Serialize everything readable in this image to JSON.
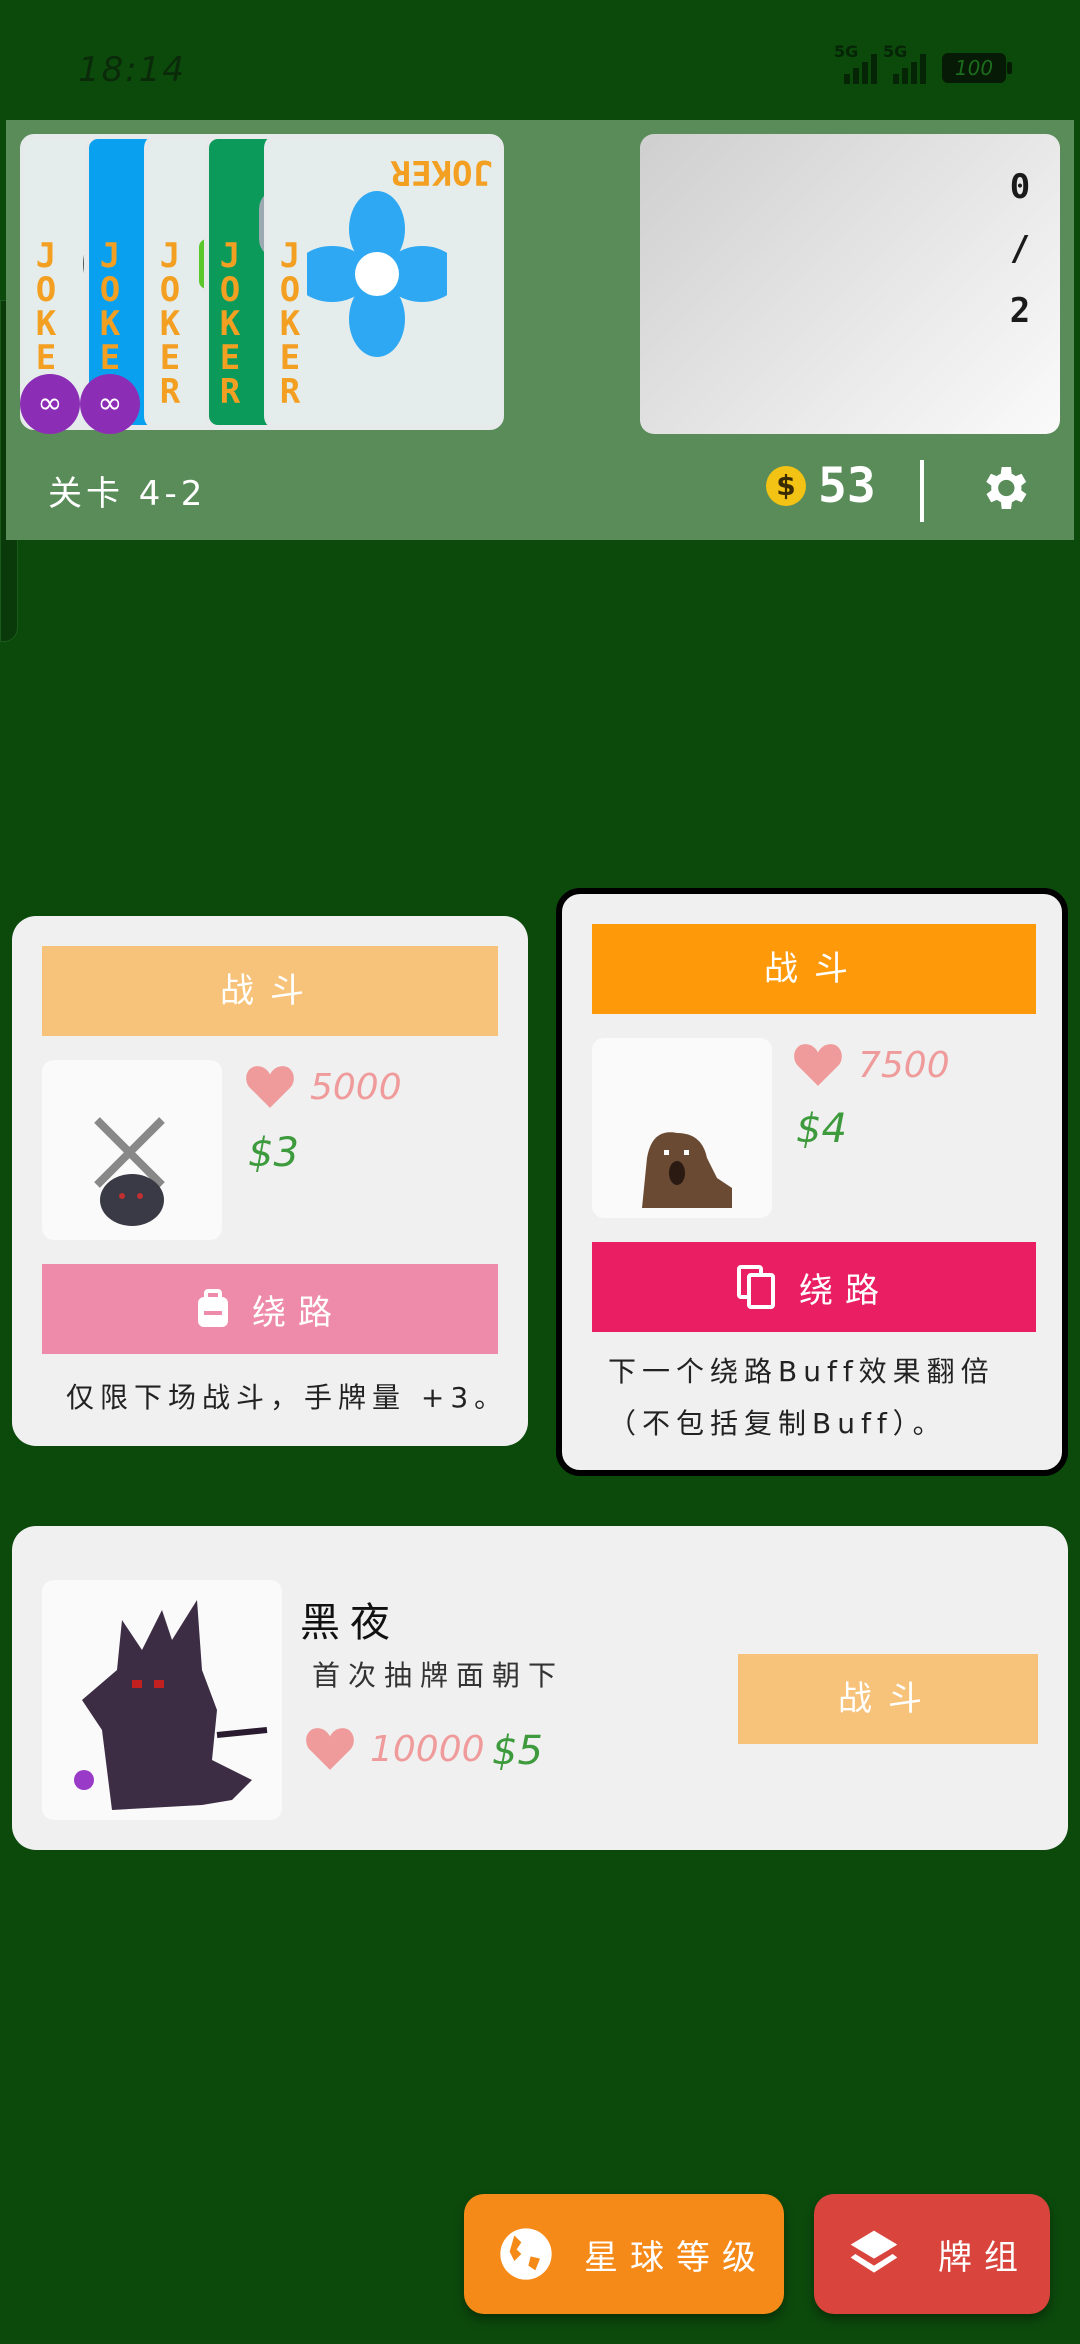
{
  "status_bar": {
    "time": "18:14",
    "network_1": "5G",
    "network_2": "5G",
    "battery": "100"
  },
  "top_panel": {
    "jokers": [
      {
        "label": "JOKER",
        "color": "#e4ecec",
        "infinite": true
      },
      {
        "label": "JOKER",
        "color": "#0aa0f0",
        "infinite": true
      },
      {
        "label": "JOKER",
        "color": "#e4ecec",
        "infinite": false
      },
      {
        "label": "JOKER",
        "color": "#0c9a5a",
        "infinite": false
      },
      {
        "label": "JOKER",
        "color": "#e4ecec",
        "infinite": false
      }
    ],
    "infinite_symbol": "∞",
    "slot_counter": {
      "current": "0",
      "separator": "/",
      "max": "2"
    },
    "level_label": "关卡 4-2",
    "money": "53",
    "coin_symbol": "$"
  },
  "boss_small_1": {
    "fight_label": "战斗",
    "hp": "5000",
    "reward": "$3",
    "skip_label": "绕路",
    "description": "仅限下场战斗，手牌量 +3。",
    "colors": {
      "fight": "#f7c27a",
      "skip": "#ee8aaa"
    }
  },
  "boss_small_2": {
    "fight_label": "战斗",
    "hp": "7500",
    "reward": "$4",
    "skip_label": "绕路",
    "description_line_1": "下一个绕路Buff效果翻倍",
    "description_line_2": "（不包括复制Buff）。",
    "colors": {
      "fight": "#fe9a0a",
      "skip": "#e91e63"
    }
  },
  "boss_big": {
    "name": "黑夜",
    "effect": "首次抽牌面朝下",
    "hp": "10000",
    "reward": "$5",
    "fight_label": "战斗",
    "colors": {
      "fight": "#f7c27a"
    }
  },
  "bottom": {
    "planet_label": "星球等级",
    "deck_label": "牌组",
    "colors": {
      "planet": "#f68a18",
      "deck": "#d9443d"
    }
  },
  "colors": {
    "background": "#0c4a0c",
    "panel": "#5a8c5a",
    "heart": "#f09b9b",
    "money": "#3d9a3d"
  }
}
